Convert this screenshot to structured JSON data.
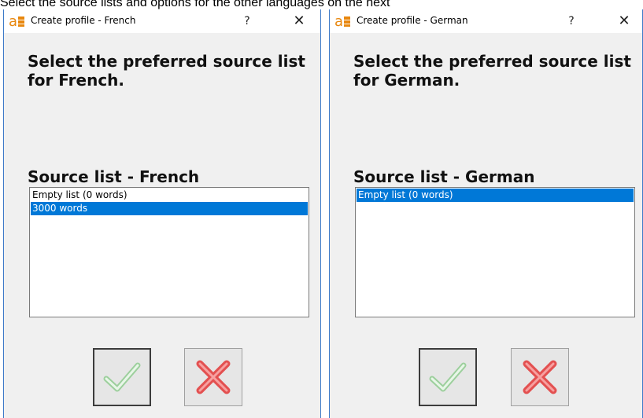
{
  "caption": "Select the source lists and options for the other languages on the next",
  "colors": {
    "selection": "#0078d7",
    "window_border": "#3d7ac8",
    "dialog_bg": "#f0f0f0"
  },
  "dialogs": [
    {
      "title": "Create profile - French",
      "help_glyph": "?",
      "close_glyph": "✕",
      "heading": "Select the preferred source list for French.",
      "list_label": "Source list - French",
      "items": [
        {
          "label": "Empty list (0 words)",
          "selected": false
        },
        {
          "label": "3000 words",
          "selected": true
        }
      ],
      "ok_icon": "check-icon",
      "cancel_icon": "x-icon"
    },
    {
      "title": "Create profile - German",
      "help_glyph": "?",
      "close_glyph": "✕",
      "heading": "Select the preferred source list for German.",
      "list_label": "Source list - German",
      "items": [
        {
          "label": "Empty list (0 words)",
          "selected": true
        }
      ],
      "ok_icon": "check-icon",
      "cancel_icon": "x-icon"
    }
  ]
}
